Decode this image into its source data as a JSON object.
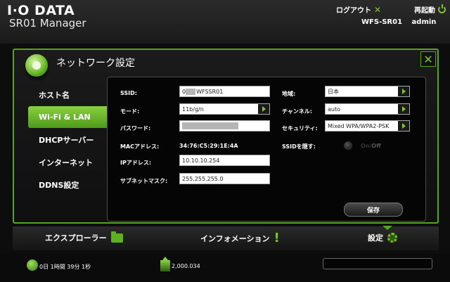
{
  "header": {
    "brand": "I·O DATA",
    "app_name": "SR01 Manager",
    "logout_label": "ログアウト",
    "restart_label": "再起動",
    "device_name": "WFS-SR01",
    "user": "admin"
  },
  "page": {
    "title": "ネットワーク設定"
  },
  "sidebar": {
    "items": [
      {
        "label": "ホスト名",
        "active": false
      },
      {
        "label": "Wi-Fi & LAN",
        "active": true
      },
      {
        "label": "DHCPサーバー",
        "active": false
      },
      {
        "label": "インターネット",
        "active": false
      },
      {
        "label": "DDNS設定",
        "active": false
      }
    ]
  },
  "form": {
    "ssid": {
      "label": "SSID:",
      "value_prefix": "0",
      "value": "WFSSR01"
    },
    "mode": {
      "label": "モード:",
      "value": "11b/g/n"
    },
    "password": {
      "label": "パスワード:"
    },
    "mac": {
      "label": "MACアドレス:",
      "value": "34:76:C5:29:1E:4A"
    },
    "ip": {
      "label": "IPアドレス:",
      "value": "10.10.10.254"
    },
    "subnet": {
      "label": "サブネットマスク:",
      "value": "255.255.255.0"
    },
    "region": {
      "label": "地域:",
      "value": "日本"
    },
    "channel": {
      "label": "チャンネル:",
      "value": "auto"
    },
    "security": {
      "label": "セキュリティ:",
      "value": "Mixed WPA/WPA2-PSK"
    },
    "hide_ssid": {
      "label": "SSIDを隠す:",
      "on_label": "On",
      "off_label": "Off"
    },
    "save_label": "保存"
  },
  "bottom_nav": {
    "explorer": "エクスプローラー",
    "info": "インフォメーション",
    "settings": "設定"
  },
  "status": {
    "uptime": "0日 1時間 39分 1秒",
    "data": "2,000.034"
  },
  "colors": {
    "accent": "#7fc62d",
    "frame": "#55a51d"
  }
}
